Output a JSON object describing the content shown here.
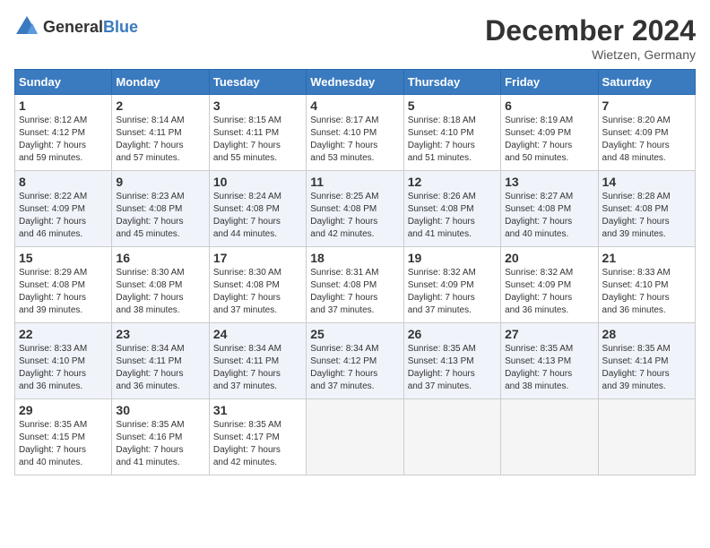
{
  "logo": {
    "general": "General",
    "blue": "Blue"
  },
  "title": "December 2024",
  "location": "Wietzen, Germany",
  "days_of_week": [
    "Sunday",
    "Monday",
    "Tuesday",
    "Wednesday",
    "Thursday",
    "Friday",
    "Saturday"
  ],
  "weeks": [
    [
      {
        "day": "1",
        "sunrise": "8:12 AM",
        "sunset": "4:12 PM",
        "daylight": "7 hours and 59 minutes."
      },
      {
        "day": "2",
        "sunrise": "8:14 AM",
        "sunset": "4:11 PM",
        "daylight": "7 hours and 57 minutes."
      },
      {
        "day": "3",
        "sunrise": "8:15 AM",
        "sunset": "4:11 PM",
        "daylight": "7 hours and 55 minutes."
      },
      {
        "day": "4",
        "sunrise": "8:17 AM",
        "sunset": "4:10 PM",
        "daylight": "7 hours and 53 minutes."
      },
      {
        "day": "5",
        "sunrise": "8:18 AM",
        "sunset": "4:10 PM",
        "daylight": "7 hours and 51 minutes."
      },
      {
        "day": "6",
        "sunrise": "8:19 AM",
        "sunset": "4:09 PM",
        "daylight": "7 hours and 50 minutes."
      },
      {
        "day": "7",
        "sunrise": "8:20 AM",
        "sunset": "4:09 PM",
        "daylight": "7 hours and 48 minutes."
      }
    ],
    [
      {
        "day": "8",
        "sunrise": "8:22 AM",
        "sunset": "4:09 PM",
        "daylight": "7 hours and 46 minutes."
      },
      {
        "day": "9",
        "sunrise": "8:23 AM",
        "sunset": "4:08 PM",
        "daylight": "7 hours and 45 minutes."
      },
      {
        "day": "10",
        "sunrise": "8:24 AM",
        "sunset": "4:08 PM",
        "daylight": "7 hours and 44 minutes."
      },
      {
        "day": "11",
        "sunrise": "8:25 AM",
        "sunset": "4:08 PM",
        "daylight": "7 hours and 42 minutes."
      },
      {
        "day": "12",
        "sunrise": "8:26 AM",
        "sunset": "4:08 PM",
        "daylight": "7 hours and 41 minutes."
      },
      {
        "day": "13",
        "sunrise": "8:27 AM",
        "sunset": "4:08 PM",
        "daylight": "7 hours and 40 minutes."
      },
      {
        "day": "14",
        "sunrise": "8:28 AM",
        "sunset": "4:08 PM",
        "daylight": "7 hours and 39 minutes."
      }
    ],
    [
      {
        "day": "15",
        "sunrise": "8:29 AM",
        "sunset": "4:08 PM",
        "daylight": "7 hours and 39 minutes."
      },
      {
        "day": "16",
        "sunrise": "8:30 AM",
        "sunset": "4:08 PM",
        "daylight": "7 hours and 38 minutes."
      },
      {
        "day": "17",
        "sunrise": "8:30 AM",
        "sunset": "4:08 PM",
        "daylight": "7 hours and 37 minutes."
      },
      {
        "day": "18",
        "sunrise": "8:31 AM",
        "sunset": "4:08 PM",
        "daylight": "7 hours and 37 minutes."
      },
      {
        "day": "19",
        "sunrise": "8:32 AM",
        "sunset": "4:09 PM",
        "daylight": "7 hours and 37 minutes."
      },
      {
        "day": "20",
        "sunrise": "8:32 AM",
        "sunset": "4:09 PM",
        "daylight": "7 hours and 36 minutes."
      },
      {
        "day": "21",
        "sunrise": "8:33 AM",
        "sunset": "4:10 PM",
        "daylight": "7 hours and 36 minutes."
      }
    ],
    [
      {
        "day": "22",
        "sunrise": "8:33 AM",
        "sunset": "4:10 PM",
        "daylight": "7 hours and 36 minutes."
      },
      {
        "day": "23",
        "sunrise": "8:34 AM",
        "sunset": "4:11 PM",
        "daylight": "7 hours and 36 minutes."
      },
      {
        "day": "24",
        "sunrise": "8:34 AM",
        "sunset": "4:11 PM",
        "daylight": "7 hours and 37 minutes."
      },
      {
        "day": "25",
        "sunrise": "8:34 AM",
        "sunset": "4:12 PM",
        "daylight": "7 hours and 37 minutes."
      },
      {
        "day": "26",
        "sunrise": "8:35 AM",
        "sunset": "4:13 PM",
        "daylight": "7 hours and 37 minutes."
      },
      {
        "day": "27",
        "sunrise": "8:35 AM",
        "sunset": "4:13 PM",
        "daylight": "7 hours and 38 minutes."
      },
      {
        "day": "28",
        "sunrise": "8:35 AM",
        "sunset": "4:14 PM",
        "daylight": "7 hours and 39 minutes."
      }
    ],
    [
      {
        "day": "29",
        "sunrise": "8:35 AM",
        "sunset": "4:15 PM",
        "daylight": "7 hours and 40 minutes."
      },
      {
        "day": "30",
        "sunrise": "8:35 AM",
        "sunset": "4:16 PM",
        "daylight": "7 hours and 41 minutes."
      },
      {
        "day": "31",
        "sunrise": "8:35 AM",
        "sunset": "4:17 PM",
        "daylight": "7 hours and 42 minutes."
      },
      null,
      null,
      null,
      null
    ]
  ],
  "labels": {
    "sunrise": "Sunrise:",
    "sunset": "Sunset:",
    "daylight": "Daylight:"
  }
}
